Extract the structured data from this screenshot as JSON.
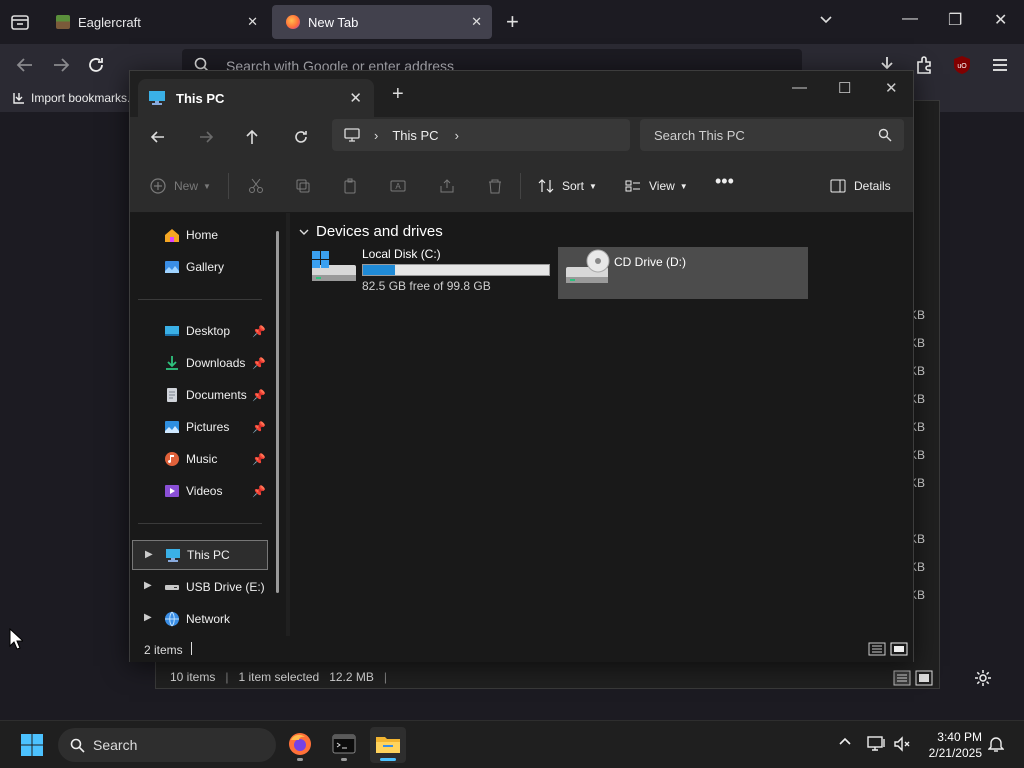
{
  "browser": {
    "tabs": [
      {
        "title": "Eaglercraft",
        "active": false
      },
      {
        "title": "New Tab",
        "active": true
      }
    ],
    "urlbar_placeholder": "Search with Google or enter address",
    "bookmarks_toolbar": {
      "import_label": "Import bookmarks..."
    }
  },
  "explorer": {
    "tab_title": "This PC",
    "address": {
      "location": "This PC"
    },
    "search_placeholder": "Search This PC",
    "commandbar": {
      "new_label": "New",
      "sort_label": "Sort",
      "view_label": "View",
      "details_label": "Details"
    },
    "nav": {
      "quick": [
        {
          "label": "Home"
        },
        {
          "label": "Gallery"
        }
      ],
      "pinned": [
        {
          "label": "Desktop"
        },
        {
          "label": "Downloads"
        },
        {
          "label": "Documents"
        },
        {
          "label": "Pictures"
        },
        {
          "label": "Music"
        },
        {
          "label": "Videos"
        }
      ],
      "tree": [
        {
          "label": "This PC",
          "selected": true
        },
        {
          "label": "USB Drive (E:)"
        },
        {
          "label": "Network"
        }
      ]
    },
    "group_header": "Devices and drives",
    "drives": [
      {
        "name": "Local Disk (C:)",
        "free_text": "82.5 GB free of 99.8 GB",
        "used_fraction": 0.173
      },
      {
        "name": "CD Drive (D:)",
        "selected": true
      }
    ],
    "status": {
      "item_count": "2 items"
    }
  },
  "background_explorer": {
    "size_column": [
      "KB",
      "KB",
      "KB",
      "KB",
      "KB",
      "KB",
      "KB",
      "KB",
      "KB",
      "KB"
    ],
    "status": {
      "item_count": "10 items",
      "selection": "1 item selected",
      "size": "12.2 MB"
    }
  },
  "taskbar": {
    "search_label": "Search",
    "time": "3:40 PM",
    "date": "2/21/2025"
  },
  "colors": {
    "accent": "#1f8ad6",
    "active_tab": "#42414d",
    "selection": "#4c4c4c"
  }
}
